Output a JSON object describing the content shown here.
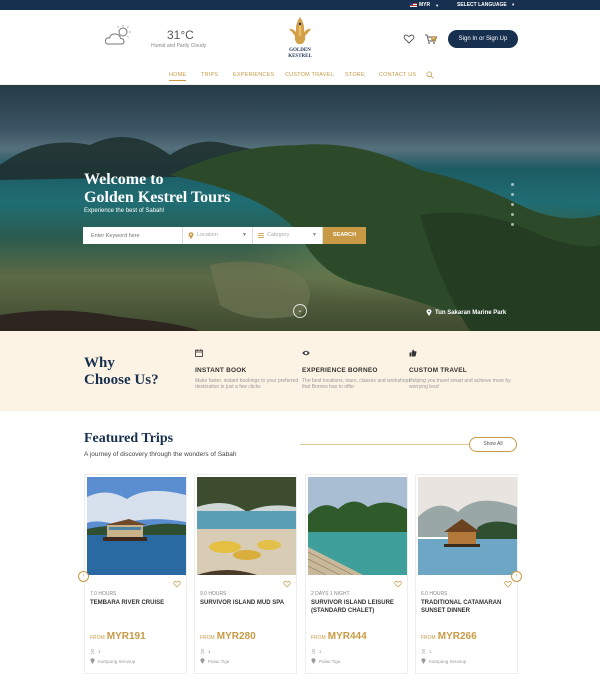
{
  "topbar": {
    "currency": "MYR",
    "language": "SELECT LANGUAGE"
  },
  "weather": {
    "temp": "31°C",
    "condition": "Humid and Partly Cloudy"
  },
  "brand": {
    "line1": "GOLDEN",
    "line2": "KESTREL"
  },
  "header": {
    "signin": "Sign In or Sign Up",
    "cart_count": "0"
  },
  "nav": [
    {
      "label": "HOME"
    },
    {
      "label": "TRIPS"
    },
    {
      "label": "EXPERIENCES"
    },
    {
      "label": "CUSTOM TRAVEL"
    },
    {
      "label": "STORE"
    },
    {
      "label": "CONTACT US"
    }
  ],
  "hero": {
    "title_line1": "Welcome to",
    "title_line2": "Golden Kestrel Tours",
    "subtitle": "Experience the best of Sabah!",
    "keyword_placeholder": "Enter Keyword here",
    "location": "Location",
    "category": "Category",
    "search": "SEARCH",
    "place": "Tun Sakaran Marine Park"
  },
  "why": {
    "title_line1": "Why",
    "title_line2": "Choose Us?",
    "features": [
      {
        "title": "INSTANT BOOK",
        "desc": "Make faster, instant bookings to your preferred destination in just a few clicks"
      },
      {
        "title": "EXPERIENCE BORNEO",
        "desc": "The best locations, tours, classes and workshops that Borneo has to offer"
      },
      {
        "title": "CUSTOM TRAVEL",
        "desc": "Helping you travel smart and achieve more by worrying less!"
      }
    ]
  },
  "featured": {
    "title": "Featured Trips",
    "subtitle": "A journey of discovery through the wonders of Sabah",
    "show_all": "Show All",
    "trips": [
      {
        "duration": "7.0 HOURS",
        "name": "TEMBARA RIVER CRUISE",
        "from": "FROM",
        "price": "MYR191",
        "pax": "1",
        "location": "Kampung Serusup"
      },
      {
        "duration": "9.0 HOURS",
        "name": "SURVIVOR ISLAND MUD SPA",
        "from": "FROM",
        "price": "MYR280",
        "pax": "1",
        "location": "Pulau Tiga"
      },
      {
        "duration": "2 DAYS 1 NIGHT",
        "name": "SURVIVOR ISLAND LEISURE (STANDARD CHALET)",
        "from": "FROM",
        "price": "MYR444",
        "pax": "1",
        "location": "Pulau Tiga"
      },
      {
        "duration": "6.0 HOURS",
        "name": "TRADITIONAL CATAMARAN SUNSET DINNER",
        "from": "FROM",
        "price": "MYR266",
        "pax": "1",
        "location": "Kampung Serusup"
      }
    ]
  },
  "colors": {
    "navy": "#18304f",
    "gold": "#c89a45",
    "cream": "#fdf3e4"
  }
}
